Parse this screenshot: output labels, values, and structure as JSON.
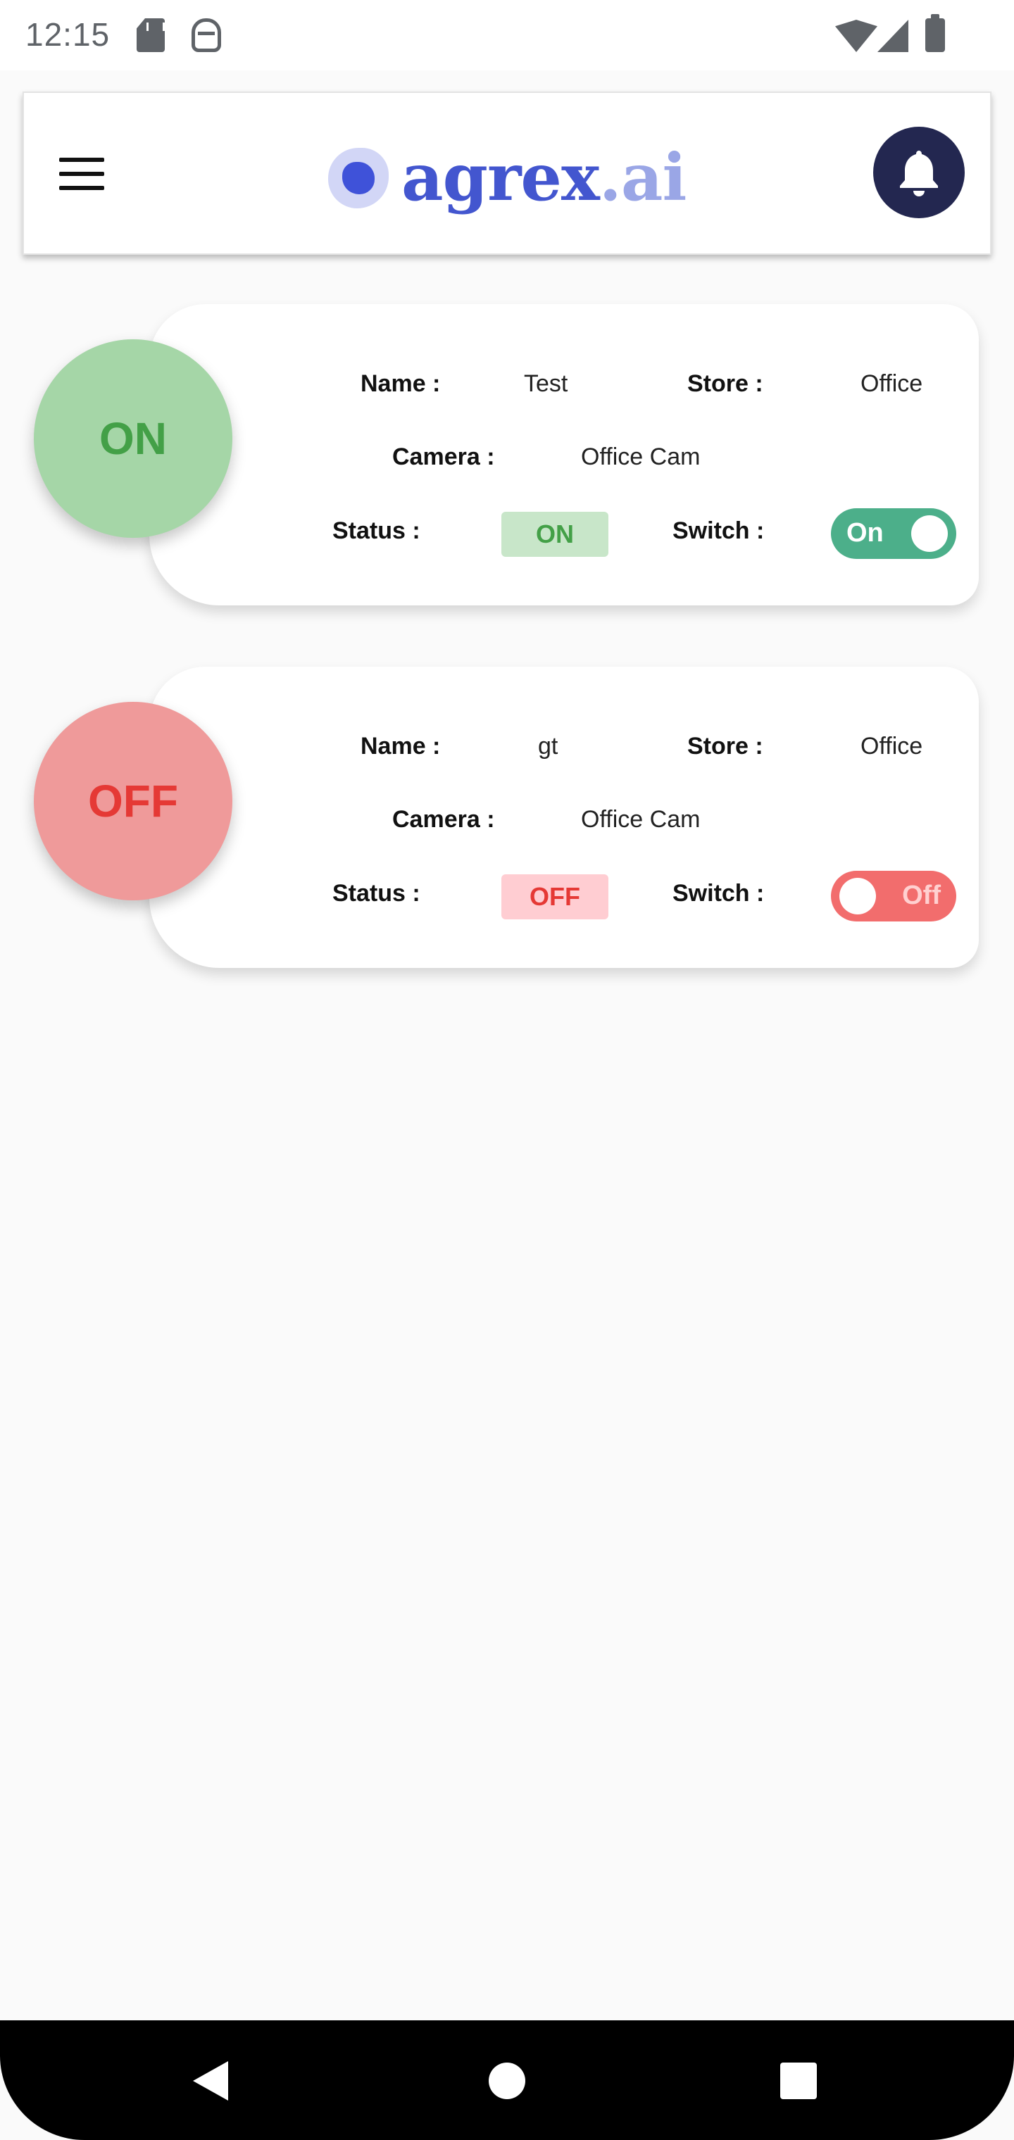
{
  "status_bar": {
    "time": "12:15",
    "icons": [
      "sd-card-icon",
      "bot-icon",
      "wifi-icon",
      "signal-icon",
      "battery-icon"
    ]
  },
  "header": {
    "logo_main": "agrex",
    "logo_suffix": ".ai",
    "menu_icon": "hamburger-menu-icon",
    "notification_icon": "bell-icon"
  },
  "labels": {
    "name": "Name :",
    "store": "Store :",
    "camera": "Camera :",
    "status": "Status :",
    "switch": "Switch  :"
  },
  "cameras": [
    {
      "state": "ON",
      "name": "Test",
      "store": "Office",
      "camera": "Office Cam",
      "status": "ON",
      "switch_label": "On",
      "switch_on": true
    },
    {
      "state": "OFF",
      "name": "gt",
      "store": "Office",
      "camera": "Office Cam",
      "status": "OFF",
      "switch_label": "Off",
      "switch_on": false
    }
  ],
  "colors": {
    "on_circle": "#a5d6a7",
    "on_text": "#43a047",
    "off_circle": "#ef9a9a",
    "off_text": "#e53935",
    "toggle_on": "#4caf8a",
    "toggle_off": "#f26d6d",
    "bell_background": "#232750",
    "logo_primary": "#4356cf",
    "logo_secondary": "#9aa6e6"
  },
  "nav": {
    "icons": [
      "back-icon",
      "home-icon",
      "recents-icon"
    ]
  }
}
